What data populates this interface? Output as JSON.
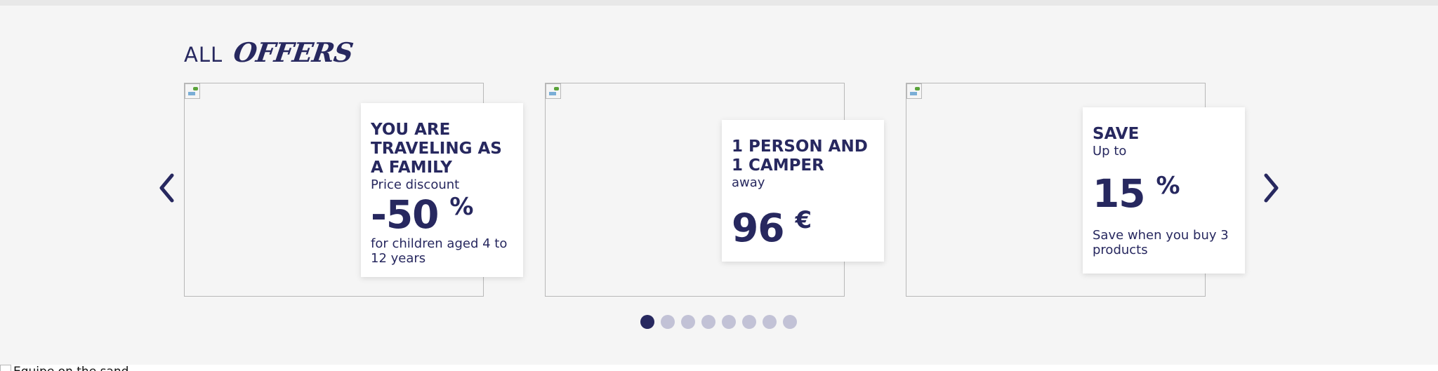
{
  "section": {
    "heading_plain": "ALL",
    "heading_script": "Offers"
  },
  "carousel": {
    "prev_icon": "chevron-left-icon",
    "next_icon": "chevron-right-icon",
    "accent_color": "#27285f",
    "dot_inactive_color": "#c2c2d6",
    "active_slide": 1,
    "slide_count": 8
  },
  "offers": [
    {
      "title": "YOU ARE TRAVELING AS A FAMILY",
      "subtitle": "Price discount",
      "value": "-50",
      "unit": "%",
      "note": "for children aged 4 to 12 years"
    },
    {
      "title": "1 PERSON AND 1 CAMPER",
      "subtitle": "away",
      "value": "96",
      "unit": "€",
      "note": ""
    },
    {
      "title": "SAVE",
      "subtitle": "Up to",
      "value": "15",
      "unit": "%",
      "note": "Save when you buy 3 products"
    }
  ],
  "footer": {
    "image_alt": "Equipe on the sand"
  }
}
